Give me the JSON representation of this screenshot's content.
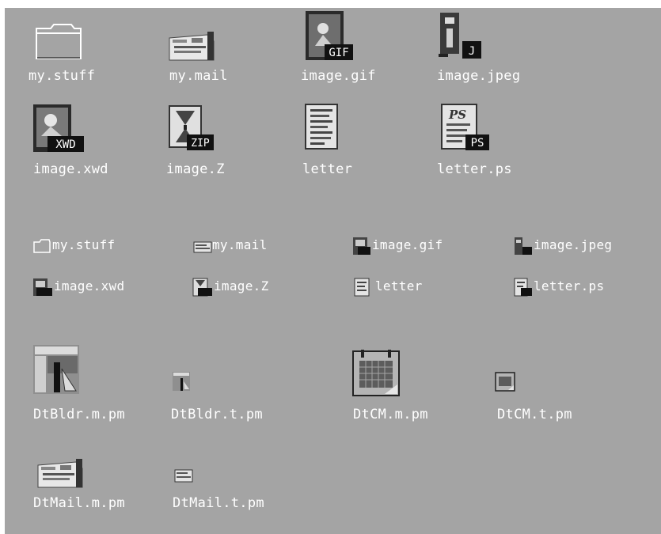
{
  "view": {
    "background": "#a4a4a4",
    "label_color": "#ffffff"
  },
  "large_icons": [
    {
      "label": "my.stuff",
      "icon": "folder-icon"
    },
    {
      "label": "my.mail",
      "icon": "mail-icon"
    },
    {
      "label": "image.gif",
      "icon": "gif-image-icon",
      "badge": "GIF"
    },
    {
      "label": "image.jpeg",
      "icon": "jpeg-image-icon",
      "badge": "J"
    },
    {
      "label": "image.xwd",
      "icon": "xwd-image-icon",
      "badge": "XWD"
    },
    {
      "label": "image.Z",
      "icon": "compressed-file-icon",
      "badge": "ZIP"
    },
    {
      "label": "letter",
      "icon": "text-document-icon"
    },
    {
      "label": "letter.ps",
      "icon": "postscript-document-icon",
      "badge": "PS",
      "stamp": "PS"
    }
  ],
  "small_icons": [
    {
      "label": "my.stuff",
      "icon": "folder-icon"
    },
    {
      "label": "my.mail",
      "icon": "mail-icon"
    },
    {
      "label": "image.gif",
      "icon": "gif-image-icon",
      "badge": "GIF"
    },
    {
      "label": "image.jpeg",
      "icon": "jpeg-image-icon",
      "badge": "J"
    },
    {
      "label": "image.xwd",
      "icon": "xwd-image-icon",
      "badge": "XWD"
    },
    {
      "label": "image.Z",
      "icon": "compressed-file-icon",
      "badge": "ZIP"
    },
    {
      "label": "letter",
      "icon": "text-document-icon"
    },
    {
      "label": "letter.ps",
      "icon": "postscript-document-icon",
      "badge": "PS"
    }
  ],
  "pixmap_icons": [
    {
      "label": "DtBldr.m.pm",
      "icon": "app-builder-icon"
    },
    {
      "label": "DtBldr.t.pm",
      "icon": "app-builder-icon"
    },
    {
      "label": "DtCM.m.pm",
      "icon": "calendar-icon"
    },
    {
      "label": "DtCM.t.pm",
      "icon": "calendar-icon"
    },
    {
      "label": "DtMail.m.pm",
      "icon": "mail-icon"
    },
    {
      "label": "DtMail.t.pm",
      "icon": "mail-icon"
    }
  ]
}
